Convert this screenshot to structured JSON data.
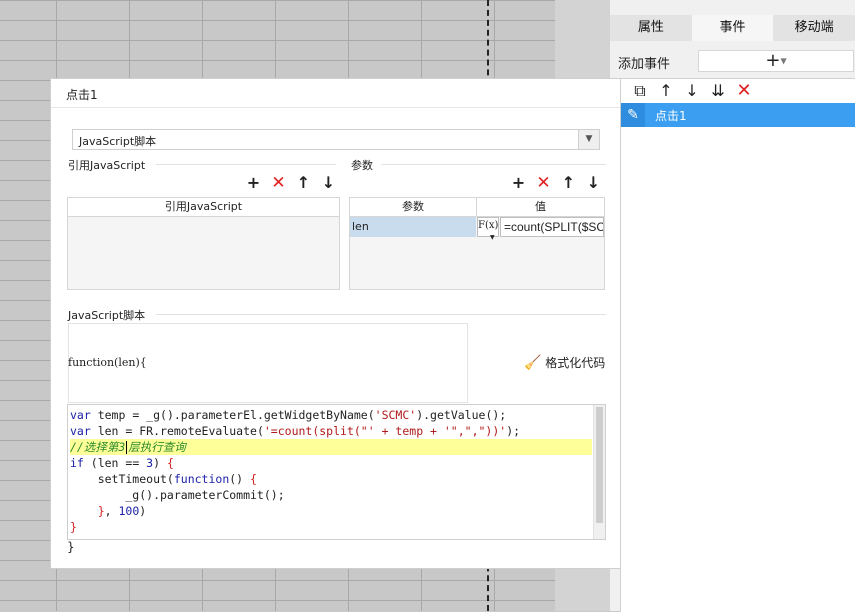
{
  "right_panel": {
    "tabs": [
      "属性",
      "事件",
      "移动端"
    ],
    "active_tab": "事件",
    "add_event_label": "添加事件",
    "add_button_glyph": "+",
    "selected_event": "点击1"
  },
  "dialog": {
    "title": "点击1",
    "script_type": "JavaScript脚本",
    "ref_section_label": "引用JavaScript",
    "ref_table_header": "引用JavaScript",
    "params_section_label": "参数",
    "params_table_headers": [
      "参数",
      "值"
    ],
    "params_rows": [
      {
        "name": "len",
        "fx": "F(x)",
        "value": "=count(SPLIT($SCMC"
      }
    ],
    "js_section_label": "JavaScript脚本",
    "function_signature": "function(len){",
    "format_button_label": "格式化代码",
    "code_lines": [
      "var temp = _g().parameterEl.getWidgetByName('SCMC').getValue();",
      "var len = FR.remoteEvaluate('=count(split(\"' + temp + '\",\",\"))');",
      "//选择第3层执行查询",
      "if (len == 3) {",
      "    setTimeout(function() {",
      "        _g().parameterCommit();",
      "    }, 100)",
      "}"
    ],
    "closing_brace": "}"
  },
  "colors": {
    "accent": "#3b9ef1",
    "delete_red": "#e02020",
    "highlight_line": "#ffff99"
  }
}
